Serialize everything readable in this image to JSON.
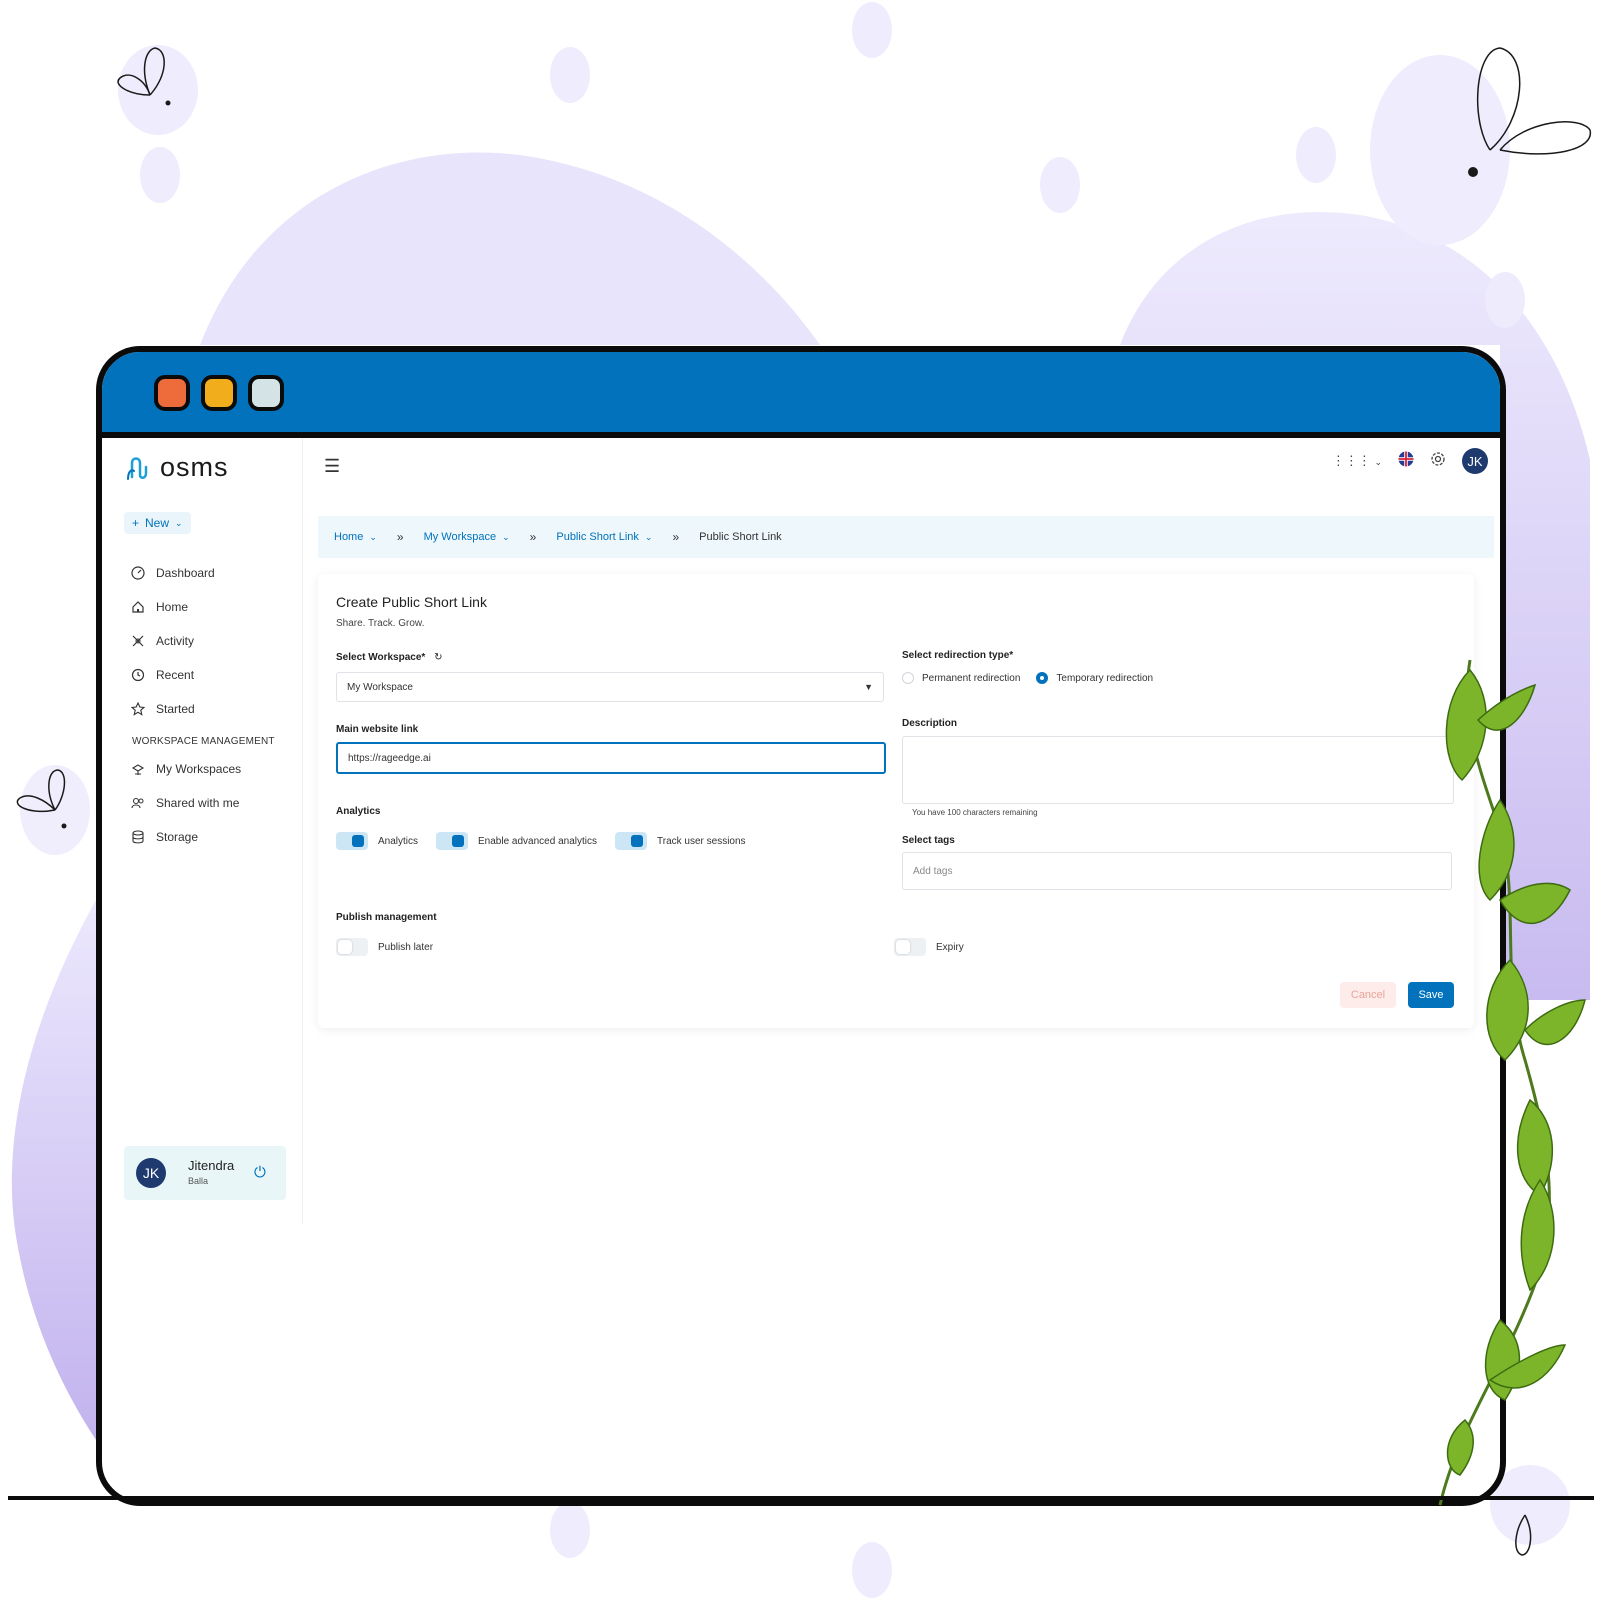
{
  "logo": {
    "text": "osms"
  },
  "sidebar": {
    "new_label": "New",
    "items": [
      {
        "label": "Dashboard",
        "icon": "gauge-icon"
      },
      {
        "label": "Home",
        "icon": "home-icon"
      },
      {
        "label": "Activity",
        "icon": "activity-icon"
      },
      {
        "label": "Recent",
        "icon": "history-icon"
      },
      {
        "label": "Started",
        "icon": "star-icon"
      }
    ],
    "section_title": "WORKSPACE MANAGEMENT",
    "workspace_items": [
      {
        "label": "My Workspaces",
        "icon": "workspace-icon"
      },
      {
        "label": "Shared with me",
        "icon": "users-icon"
      },
      {
        "label": "Storage",
        "icon": "database-icon"
      }
    ]
  },
  "user": {
    "initials": "JK",
    "name": "Jitendra",
    "surname": "Balla"
  },
  "header": {
    "avatar_initials": "JK"
  },
  "breadcrumb": {
    "items": [
      "Home",
      "My Workspace",
      "Public Short Link"
    ],
    "current": "Public Short Link",
    "separator": "»"
  },
  "form": {
    "title": "Create Public Short Link",
    "subtitle": "Share. Track. Grow.",
    "workspace_label": "Select Workspace*",
    "workspace_value": "My Workspace",
    "link_label": "Main website link",
    "link_value": "https://rageedge.ai",
    "redirect_label": "Select redirection type*",
    "redirect_permanent": "Permanent redirection",
    "redirect_temporary": "Temporary redirection",
    "description_label": "Description",
    "description_hint": "You have 100 characters remaining",
    "analytics_label": "Analytics",
    "toggle_analytics": "Analytics",
    "toggle_advanced": "Enable advanced analytics",
    "toggle_sessions": "Track user sessions",
    "tags_label": "Select tags",
    "tags_placeholder": "Add tags",
    "publish_label": "Publish management",
    "publish_later": "Publish later",
    "expiry": "Expiry",
    "cancel": "Cancel",
    "save": "Save"
  },
  "colors": {
    "accent": "#0172bb",
    "titlebar": "#0172bb",
    "blob": "#e6e1fb"
  }
}
